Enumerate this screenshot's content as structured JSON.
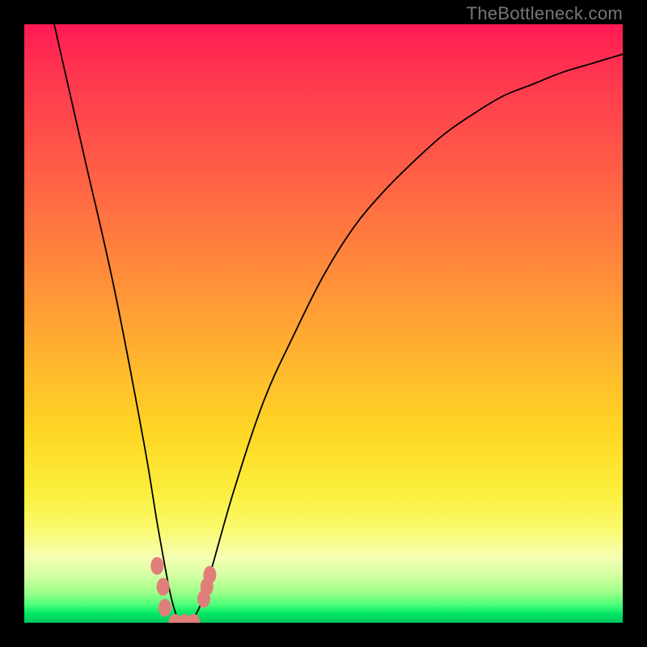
{
  "watermark": "TheBottleneck.com",
  "colors": {
    "background": "#000000",
    "marker": "#e07f7a",
    "curve": "#000000"
  },
  "chart_data": {
    "type": "line",
    "title": "",
    "xlabel": "",
    "ylabel": "",
    "xlim": [
      0,
      1
    ],
    "ylim": [
      0,
      1
    ],
    "series": [
      {
        "name": "bottleneck-curve",
        "description": "V-shaped bottleneck curve; minimum near x≈0.27 at y≈0 (green zone). Falls steeply from upper-left, bottoms out, then rises toward upper-right.",
        "x": [
          0.05,
          0.1,
          0.15,
          0.2,
          0.225,
          0.25,
          0.27,
          0.29,
          0.31,
          0.35,
          0.4,
          0.45,
          0.5,
          0.55,
          0.6,
          0.65,
          0.7,
          0.75,
          0.8,
          0.85,
          0.9,
          0.95,
          1.0
        ],
        "y": [
          1.0,
          0.78,
          0.56,
          0.3,
          0.15,
          0.025,
          0.0,
          0.02,
          0.08,
          0.22,
          0.37,
          0.48,
          0.58,
          0.66,
          0.72,
          0.77,
          0.815,
          0.85,
          0.88,
          0.9,
          0.92,
          0.935,
          0.95
        ]
      }
    ],
    "markers": {
      "name": "highlight-dots",
      "color": "#e07f7a",
      "points": [
        {
          "x": 0.222,
          "y": 0.095
        },
        {
          "x": 0.232,
          "y": 0.06
        },
        {
          "x": 0.235,
          "y": 0.025
        },
        {
          "x": 0.252,
          "y": 0.0
        },
        {
          "x": 0.268,
          "y": 0.0
        },
        {
          "x": 0.283,
          "y": 0.0
        },
        {
          "x": 0.3,
          "y": 0.04
        },
        {
          "x": 0.305,
          "y": 0.06
        },
        {
          "x": 0.31,
          "y": 0.08
        }
      ]
    }
  }
}
